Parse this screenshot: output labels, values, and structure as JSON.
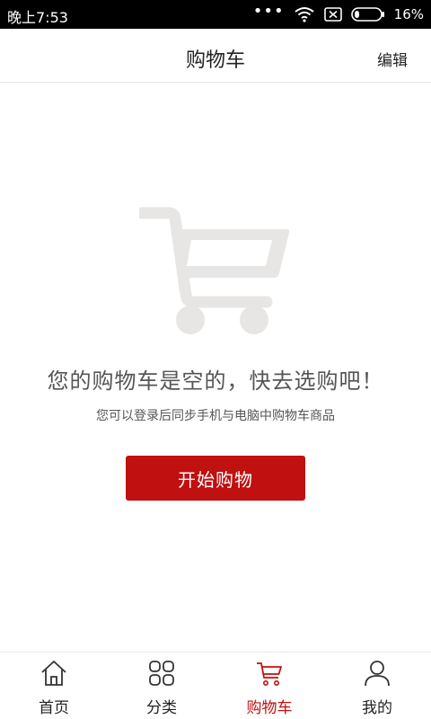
{
  "status_bar": {
    "time": "晚上7:53",
    "dots": "•••",
    "battery": "16%"
  },
  "header": {
    "title": "购物车",
    "edit_label": "编辑"
  },
  "empty_state": {
    "icon": "cart-icon",
    "title": "您的购物车是空的，快去选购吧！",
    "subtitle": "您可以登录后同步手机与电脑中购物车商品",
    "button_label": "开始购物"
  },
  "bottom_nav": {
    "items": [
      {
        "label": "首页",
        "icon": "home-icon",
        "active": false
      },
      {
        "label": "分类",
        "icon": "category-icon",
        "active": false
      },
      {
        "label": "购物车",
        "icon": "cart-icon",
        "active": true
      },
      {
        "label": "我的",
        "icon": "user-icon",
        "active": false
      }
    ]
  },
  "colors": {
    "accent": "#c01010",
    "status_bar_bg": "#000000",
    "illustration": "#e8e6e4"
  }
}
